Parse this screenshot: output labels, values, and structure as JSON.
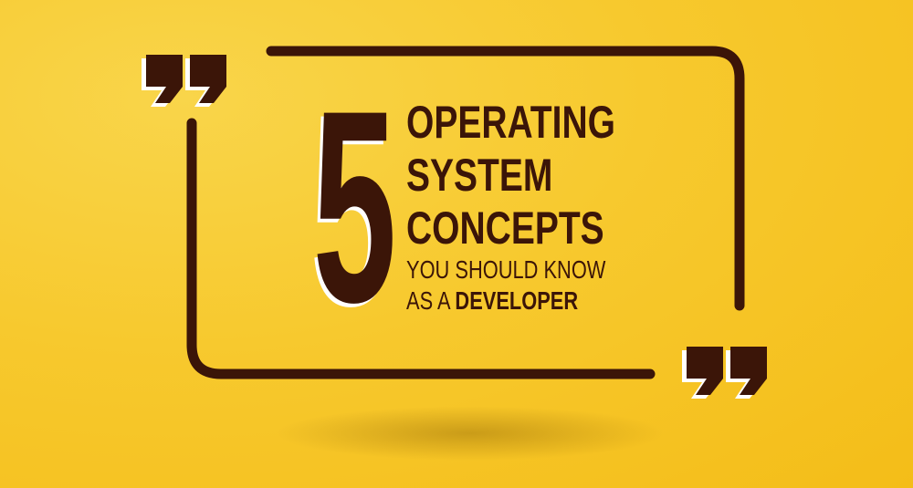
{
  "colors": {
    "background": "#f6c524",
    "ink": "#3b1508",
    "highlight": "#ffffff"
  },
  "quote_marks": {
    "open": "open-quote-icon",
    "close": "close-quote-icon"
  },
  "number": "5",
  "title": {
    "line1": "OPERATING",
    "line2": "SYSTEM",
    "line3": "CONCEPTS"
  },
  "subtitle": {
    "line1": "YOU SHOULD KNOW",
    "line2_prefix": "AS A ",
    "line2_strong": "DEVELOPER"
  }
}
